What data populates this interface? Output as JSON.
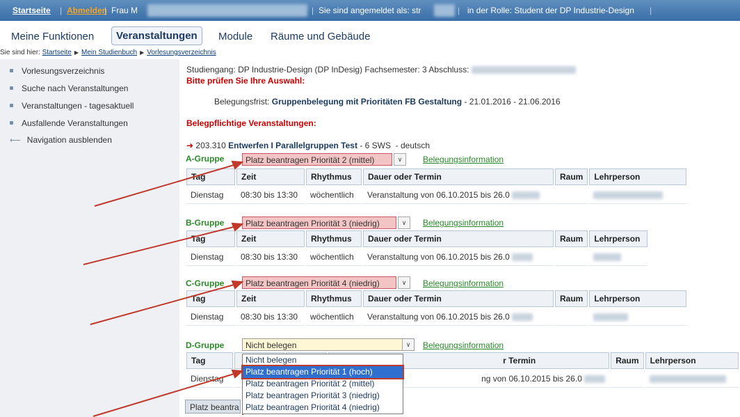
{
  "topbar": {
    "start": "Startseite",
    "logout": "Abmelden",
    "user": "Frau M",
    "logged_in": "Sie sind angemeldet als: str",
    "role": "in der Rolle: Student der DP Industrie-Design"
  },
  "mainnav": {
    "f": "Meine Funktionen",
    "v": "Veranstaltungen",
    "m": "Module",
    "r": "Räume und Gebäude"
  },
  "breadcrumb": {
    "prefix": "Sie sind hier:",
    "c1": "Startseite",
    "c2": "Mein Studienbuch",
    "c3": "Vorlesungsverzeichnis"
  },
  "sidebar": {
    "i0": "Vorlesungsverzeichnis",
    "i1": "Suche nach Veranstaltungen",
    "i2": "Veranstaltungen - tagesaktuell",
    "i3": "Ausfallende Veranstaltungen",
    "i4": "Navigation ausblenden"
  },
  "main": {
    "studiengang": "Studiengang: DP Industrie-Design (DP InDesig) Fachsemester: 3 Abschluss:",
    "pruefen": "Bitte prüfen Sie Ihre Auswahl:",
    "frist_label": "Belegungsfrist:",
    "frist_name": "Gruppenbelegung mit Prioritäten FB Gestaltung",
    "frist_dates": "- 21.01.2016 - 21.06.2016",
    "belegpflichtig": "Belegpflichtige Veranstaltungen:",
    "course_num": "203.310",
    "course_name": "Entwerfen I Parallelgruppen Test",
    "course_sws": "- 6 SWS",
    "course_lang": "- deutsch",
    "info_link": "Belegungsinformation"
  },
  "headers": {
    "tag": "Tag",
    "zeit": "Zeit",
    "rhythmus": "Rhythmus",
    "dauer": "Dauer oder Termin",
    "raum": "Raum",
    "lehrperson": "Lehrperson"
  },
  "groups": {
    "a": {
      "name": "A-Gruppe",
      "selected": "Platz beantragen Priorität 2 (mittel)",
      "tag": "Dienstag",
      "zeit": "08:30 bis 13:30",
      "rhythmus": "wöchentlich",
      "dauer": "Veranstaltung von 06.10.2015 bis 26.0"
    },
    "b": {
      "name": "B-Gruppe",
      "selected": "Platz beantragen Priorität 3 (niedrig)",
      "tag": "Dienstag",
      "zeit": "08:30 bis 13:30",
      "rhythmus": "wöchentlich",
      "dauer": "Veranstaltung von 06.10.2015 bis 26.0"
    },
    "c": {
      "name": "C-Gruppe",
      "selected": "Platz beantragen Priorität 4 (niedrig)",
      "tag": "Dienstag",
      "zeit": "08:30 bis 13:30",
      "rhythmus": "wöchentlich",
      "dauer": "Veranstaltung von 06.10.2015 bis 26.0"
    },
    "d": {
      "name": "D-Gruppe",
      "selected": "Nicht belegen",
      "tag": "Dienstag",
      "dauer_part": "r Termin",
      "dauer_val": "ng von 06.10.2015 bis 26.0"
    }
  },
  "dropdown": {
    "o0": "Nicht belegen",
    "o1": "Platz beantragen Priorität 1 (hoch)",
    "o2": "Platz beantragen Priorität 2 (mittel)",
    "o3": "Platz beantragen Priorität 3 (niedrig)",
    "o4": "Platz beantragen Priorität 4 (niedrig)"
  },
  "submit_partial": "Platz beantra",
  "icons": {
    "dropdown": "chevron-down-icon",
    "arrow": "red-arrow-icon",
    "bullet": "bullet-icon",
    "back": "back-arrow-icon"
  },
  "colors": {
    "red": "#cc0000",
    "green": "#2a8a2a",
    "nav": "#3a6ea8",
    "highlight": "#2f6fcf",
    "sel_red_bg": "#f2c4c4"
  }
}
